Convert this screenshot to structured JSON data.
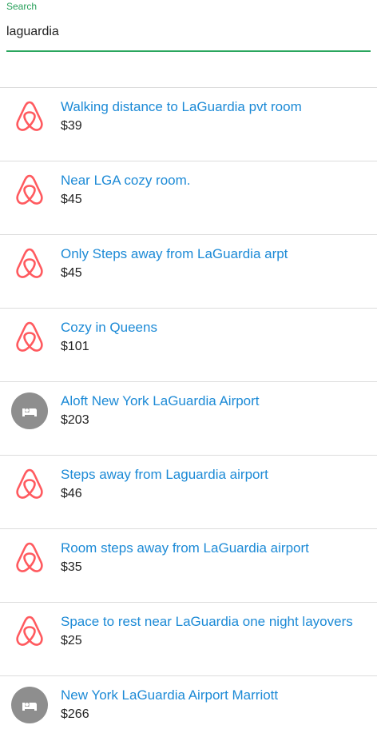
{
  "search": {
    "label": "Search",
    "value": "laguardia"
  },
  "colors": {
    "accent_green": "#2aa65e",
    "link_blue": "#1c8ad6",
    "airbnb_red": "#ff5a5f",
    "hotel_gray": "#8e8e8e"
  },
  "results": [
    {
      "title": "Walking distance to LaGuardia pvt room",
      "price": "$39",
      "icon": "airbnb-icon"
    },
    {
      "title": "Near LGA cozy room.",
      "price": "$45",
      "icon": "airbnb-icon"
    },
    {
      "title": "Only Steps away from LaGuardia arpt",
      "price": "$45",
      "icon": "airbnb-icon"
    },
    {
      "title": "Cozy in Queens",
      "price": "$101",
      "icon": "airbnb-icon"
    },
    {
      "title": "Aloft New York LaGuardia Airport",
      "price": "$203",
      "icon": "hotel-bed-icon"
    },
    {
      "title": "Steps away from Laguardia airport",
      "price": "$46",
      "icon": "airbnb-icon"
    },
    {
      "title": "Room steps away from LaGuardia airport",
      "price": "$35",
      "icon": "airbnb-icon"
    },
    {
      "title": "Space to rest near LaGuardia one night layovers",
      "price": "$25",
      "icon": "airbnb-icon"
    },
    {
      "title": "New York LaGuardia Airport Marriott",
      "price": "$266",
      "icon": "hotel-bed-icon"
    }
  ]
}
